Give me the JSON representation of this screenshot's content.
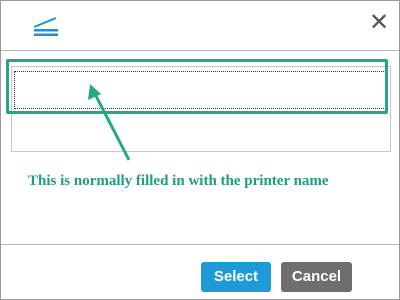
{
  "dialog": {
    "header": {
      "icon": "scanner-icon",
      "close_icon": "close-icon",
      "close_glyph": "✕"
    },
    "printer_list": {
      "items": [
        {
          "name": ""
        },
        {
          "name": ""
        }
      ],
      "selected_index": 0
    },
    "annotation": {
      "text": "This is normally filled in with the printer name",
      "color": "#27a589"
    },
    "buttons": {
      "select_label": "Select",
      "cancel_label": "Cancel",
      "select_color": "#1e9bd7",
      "cancel_color": "#6e6e6e"
    }
  }
}
